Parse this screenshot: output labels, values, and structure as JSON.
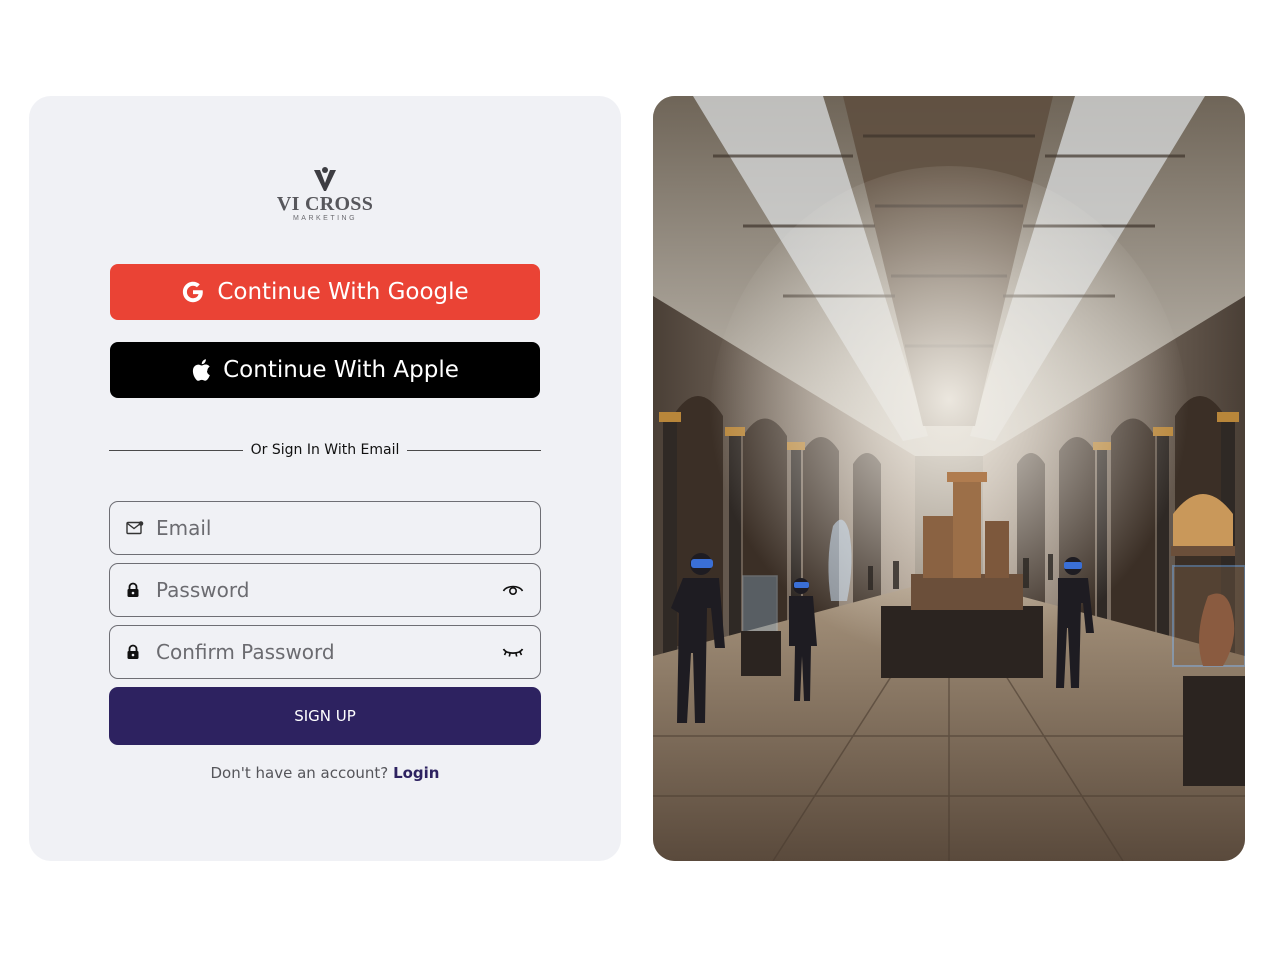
{
  "brand": {
    "name": "VI CROSS",
    "tagline": "MARKETING"
  },
  "social": {
    "google_label": "Continue With Google",
    "apple_label": "Continue With Apple"
  },
  "divider_text": "Or Sign In With Email",
  "form": {
    "email_placeholder": "Email",
    "password_placeholder": "Password",
    "confirm_placeholder": "Confirm Password",
    "signup_label": "SIGN UP"
  },
  "account": {
    "prompt": "Don't have an account?",
    "login_label": "Login"
  },
  "icons": {
    "google": "google-icon",
    "apple": "apple-icon",
    "email": "mail-icon",
    "lock": "lock-icon",
    "show_password": "eye-icon",
    "hide_password": "eye-closed-icon"
  },
  "colors": {
    "google": "#ea4335",
    "apple": "#000000",
    "primary": "#2d2260",
    "card_bg": "#f0f1f5"
  }
}
